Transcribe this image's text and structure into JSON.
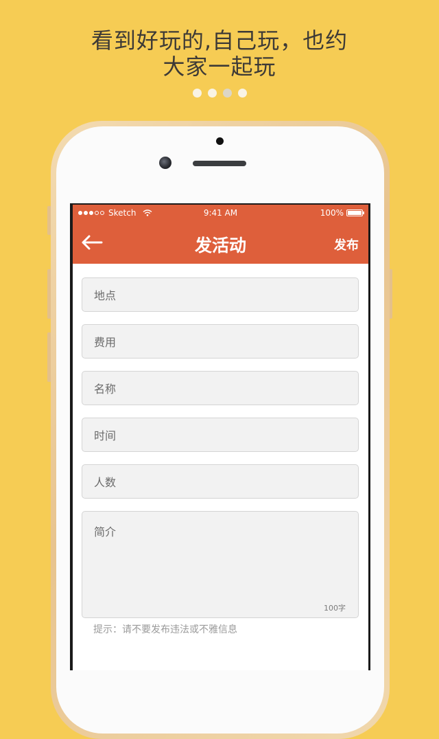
{
  "headline": {
    "line1": "看到好玩的,自己玩，也约",
    "line2": "大家一起玩"
  },
  "pager": {
    "count": 4,
    "active_index": 2
  },
  "status_bar": {
    "carrier": "Sketch",
    "time": "9:41 AM",
    "battery": "100%"
  },
  "nav": {
    "back_icon": "arrow-left-icon",
    "title": "发活动",
    "action": "发布"
  },
  "form": {
    "location": {
      "placeholder": "地点"
    },
    "fee": {
      "placeholder": "费用"
    },
    "name": {
      "placeholder": "名称"
    },
    "time": {
      "placeholder": "时间"
    },
    "people": {
      "placeholder": "人数"
    },
    "intro": {
      "placeholder": "简介",
      "limit": "100字"
    },
    "tip": "提示：请不要发布违法或不雅信息"
  },
  "colors": {
    "background": "#F6CC54",
    "accent": "#DE5F3B",
    "field_bg": "#F2F2F2"
  }
}
